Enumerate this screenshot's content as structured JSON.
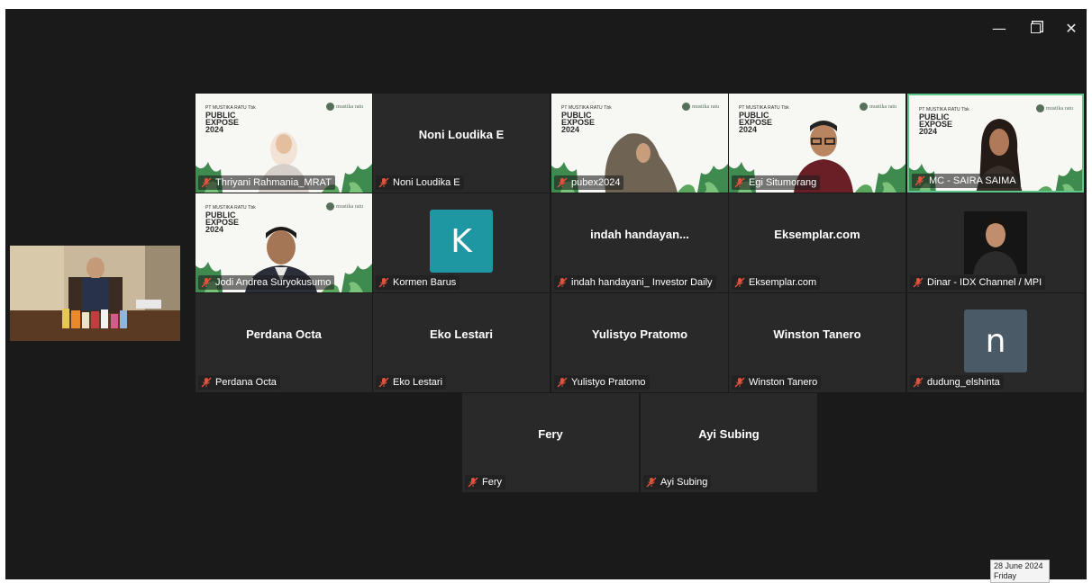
{
  "window": {
    "minimize_icon": "minimize-icon",
    "restore_icon": "restore-icon",
    "close_icon": "close-icon"
  },
  "banner": {
    "company": "PT MUSTIKA RATU Tbk",
    "line1": "PUBLIC",
    "line2": "EXPOSE",
    "line3": "2024",
    "logo": "mustika ratu"
  },
  "participants": [
    {
      "label": "Thriyani Rahmania_MRAT",
      "center": "",
      "video": "banner-woman-hijab"
    },
    {
      "label": "Noni Loudika E",
      "center": "Noni Loudika E",
      "video": "none"
    },
    {
      "label": "pubex2024",
      "center": "",
      "video": "banner-hijab-profile"
    },
    {
      "label": "Egi Situmorang",
      "center": "",
      "video": "banner-man-glasses"
    },
    {
      "label": "MC - SAIRA SAIMA",
      "center": "",
      "video": "banner-woman",
      "speaking": true
    },
    {
      "label": "Jodi Andrea Suryokusumo",
      "center": "",
      "video": "banner-man-suit"
    },
    {
      "label": "Kormen Barus",
      "center": "",
      "avatar": "K",
      "avatar_color": "#1e97a3"
    },
    {
      "label": "indah handayani_ Investor Daily",
      "center": "indah  handayan...",
      "video": "none"
    },
    {
      "label": "Eksemplar.com",
      "center": "Eksemplar.com",
      "video": "none"
    },
    {
      "label": "Dinar - IDX Channel / MPI",
      "center": "",
      "video": "photo-man"
    },
    {
      "label": "Perdana Octa",
      "center": "Perdana Octa",
      "video": "none"
    },
    {
      "label": "Eko Lestari",
      "center": "Eko Lestari",
      "video": "none"
    },
    {
      "label": "Yulistyo Pratomo",
      "center": "Yulistyo Pratomo",
      "video": "none"
    },
    {
      "label": "Winston Tanero",
      "center": "Winston Tanero",
      "video": "none"
    },
    {
      "label": "dudung_elshinta",
      "center": "",
      "avatar": "n",
      "avatar_color": "#4a5a66"
    },
    {
      "label": "Fery",
      "center": "Fery",
      "video": "none"
    },
    {
      "label": "Ayi Subing",
      "center": "Ayi Subing",
      "video": "none"
    }
  ],
  "taskbar": {
    "date": "28 June 2024",
    "day": "Friday"
  },
  "colors": {
    "meeting_bg": "#1a1a1a",
    "tile_bg": "#292929",
    "speaking_border": "#5ec78c",
    "muted_mic": "#e0533d"
  }
}
